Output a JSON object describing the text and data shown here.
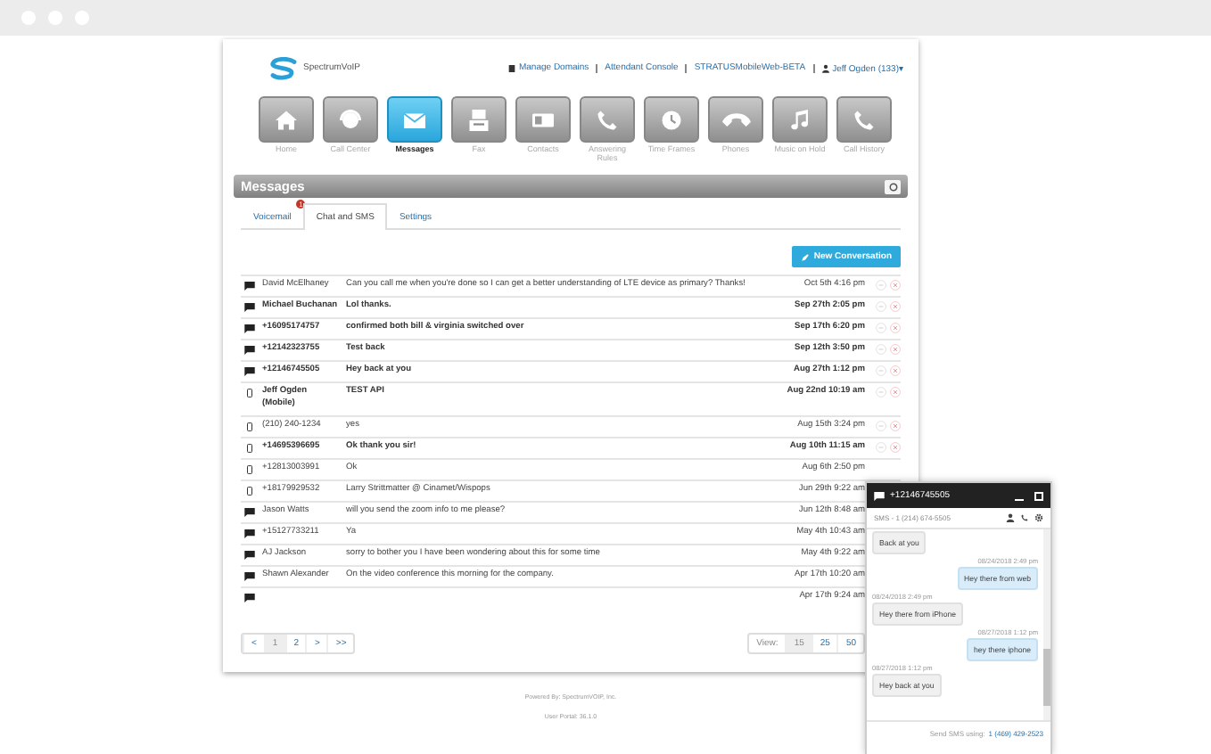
{
  "header": {
    "logo": "SpectrumVoIP",
    "links": [
      "Manage Domains",
      "Attendant Console",
      "STRATUSMobileWeb-BETA"
    ],
    "user": "Jeff Ogden (133)▾"
  },
  "nav": [
    {
      "label": "Home",
      "kind": "home",
      "selected": false
    },
    {
      "label": "Call Center",
      "kind": "headset",
      "selected": false
    },
    {
      "label": "Messages",
      "kind": "mail",
      "selected": true
    },
    {
      "label": "Fax",
      "kind": "fax",
      "selected": false
    },
    {
      "label": "Contacts",
      "kind": "card",
      "selected": false
    },
    {
      "label": "Answering Rules",
      "kind": "phone",
      "selected": false
    },
    {
      "label": "Time Frames",
      "kind": "clock",
      "selected": false
    },
    {
      "label": "Phones",
      "kind": "handset",
      "selected": false
    },
    {
      "label": "Music on Hold",
      "kind": "note",
      "selected": false
    },
    {
      "label": "Call History",
      "kind": "phone",
      "selected": false
    }
  ],
  "section_title": "Messages",
  "tabs": [
    {
      "label": "Voicemail",
      "selected": false,
      "badge": "1"
    },
    {
      "label": "Chat and SMS",
      "selected": true
    },
    {
      "label": "Settings",
      "selected": false
    }
  ],
  "new_button": "New Conversation",
  "rows": [
    {
      "kind": "chat",
      "name": "David McElhaney",
      "message": "Can you call me when you're done so I can get a better understanding of LTE device as primary? Thanks!",
      "time": "Oct 5th 4:16 pm",
      "unread": false,
      "actions": true
    },
    {
      "kind": "chat",
      "name": "Michael Buchanan",
      "message": "Lol thanks.",
      "time": "Sep 27th 2:05 pm",
      "unread": true,
      "actions": true
    },
    {
      "kind": "chat",
      "name": "+16095174757",
      "message": "confirmed both bill & virginia switched over",
      "time": "Sep 17th 6:20 pm",
      "unread": true,
      "actions": true
    },
    {
      "kind": "chat",
      "name": "+12142323755",
      "message": "Test back",
      "time": "Sep 12th 3:50 pm",
      "unread": true,
      "actions": true
    },
    {
      "kind": "chat",
      "name": "+12146745505",
      "message": "Hey back at you",
      "time": "Aug 27th 1:12 pm",
      "unread": true,
      "actions": true
    },
    {
      "kind": "mobile",
      "name": "Jeff Ogden (Mobile)",
      "message": "TEST API",
      "time": "Aug 22nd 10:19 am",
      "unread": true,
      "actions": true
    },
    {
      "kind": "mobile",
      "name": "(210) 240-1234",
      "message": "yes",
      "time": "Aug 15th 3:24 pm",
      "unread": false,
      "actions": true
    },
    {
      "kind": "mobile",
      "name": "+14695396695",
      "message": "Ok thank you sir!",
      "time": "Aug 10th 11:15 am",
      "unread": true,
      "actions": true
    },
    {
      "kind": "mobile",
      "name": "+12813003991",
      "message": "Ok",
      "time": "Aug 6th 2:50 pm",
      "unread": false
    },
    {
      "kind": "mobile",
      "name": "+18179929532",
      "message": "Larry Strittmatter @ Cinamet/Wispops",
      "time": "Jun 29th 9:22 am",
      "unread": false
    },
    {
      "kind": "chat",
      "name": "Jason Watts",
      "message": "will you send the zoom info to me please?",
      "time": "Jun 12th 8:48 am",
      "unread": false
    },
    {
      "kind": "chat",
      "name": "+15127733211",
      "message": "Ya",
      "time": "May 4th 10:43 am",
      "unread": false
    },
    {
      "kind": "chat",
      "name": "AJ Jackson",
      "message": "sorry to bother you I have been wondering about this for some time",
      "time": "May 4th 9:22 am",
      "unread": false
    },
    {
      "kind": "chat",
      "name": "Shawn Alexander",
      "message": "On the video conference this morning for the company.",
      "time": "Apr 17th 10:20 am",
      "unread": false
    },
    {
      "kind": "chat",
      "name": "",
      "message": "",
      "time": "Apr 17th 9:24 am",
      "unread": false
    }
  ],
  "pagination": [
    {
      "label": "<",
      "selected": false
    },
    {
      "label": "1",
      "selected": true
    },
    {
      "label": "2",
      "selected": false
    },
    {
      "label": ">",
      "selected": false
    },
    {
      "label": ">>",
      "selected": false
    }
  ],
  "view": {
    "label": "View:",
    "options": [
      {
        "label": "15",
        "selected": true
      },
      {
        "label": "25",
        "selected": false
      },
      {
        "label": "50",
        "selected": false
      }
    ]
  },
  "footer": [
    "Powered By: SpectrumVOIP, Inc.",
    "User Portal: 36.1.0"
  ],
  "chat": {
    "title": "+12146745505",
    "subtitle": "SMS - 1 (214) 674-5505",
    "messages": [
      {
        "kind": "incoming",
        "text": "Back at you"
      },
      {
        "kind": "outgoing",
        "time": "08/24/2018 2:49 pm",
        "text": "Hey there from web"
      },
      {
        "kind": "incoming",
        "time": "08/24/2018 2:49 pm",
        "text": "Hey there from iPhone"
      },
      {
        "kind": "outgoing",
        "time": "08/27/2018 1:12 pm",
        "text": "hey there iphone"
      },
      {
        "kind": "incoming",
        "time": "08/27/2018 1:12 pm",
        "text": "Hey back at you"
      }
    ],
    "send_label": "Send SMS using:",
    "send_number": "1 (469) 429-2523"
  }
}
